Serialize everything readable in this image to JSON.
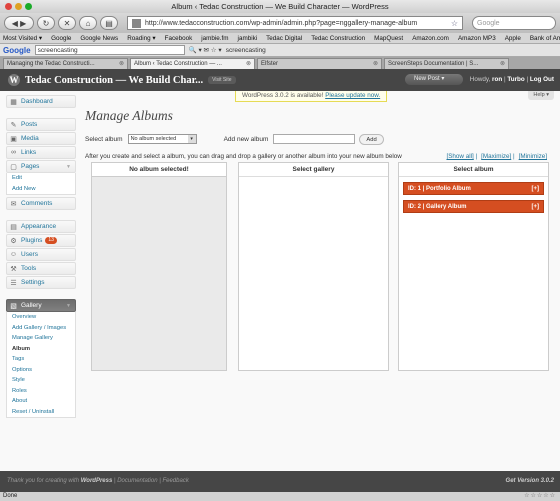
{
  "window": {
    "title": "Album ‹ Tedac Construction — We Build Character — WordPress"
  },
  "toolbar": {
    "url": "http://www.tedacconstruction.com/wp-admin/admin.php?page=nggallery-manage-album",
    "search_placeholder": "Google"
  },
  "bookmarks": [
    "Most Visited ▾",
    "Google",
    "Google News",
    "Roading ▾",
    "Facebook",
    "jambie.fm",
    "jambiki",
    "Tedac Digital",
    "Tedac Construction",
    "MapQuest",
    "Amazon.com",
    "Amazon MP3",
    "Apple",
    "Bank of America"
  ],
  "google_toolbar": {
    "logo": "Google",
    "search_value": "screencasting",
    "term": "screencasting"
  },
  "tabs": [
    {
      "label": "Managing the Tedac Constructi...",
      "active": false
    },
    {
      "label": "Album ‹ Tedac Construction — ...",
      "active": true
    },
    {
      "label": "Elfster",
      "active": false
    },
    {
      "label": "ScreenSteps Documentation | S...",
      "active": false
    }
  ],
  "wp_header": {
    "site_title": "Tedac Construction — We Build Char...",
    "visit_site": "Visit Site",
    "new_post": "New Post",
    "howdy_prefix": "Howdy,",
    "user": "ron",
    "turbo": "Turbo",
    "logout": "Log Out"
  },
  "notice": {
    "text": "WordPress 3.0.2 is available!",
    "link": "Please update now.",
    "help": "Help ▾"
  },
  "sidebar": {
    "dashboard": "Dashboard",
    "posts": "Posts",
    "media": "Media",
    "links": "Links",
    "pages": "Pages",
    "pages_sub": [
      "Edit",
      "Add New"
    ],
    "comments": "Comments",
    "appearance": "Appearance",
    "plugins": "Plugins",
    "plugins_badge": "13",
    "users": "Users",
    "tools": "Tools",
    "settings": "Settings",
    "gallery": "Gallery",
    "gallery_sub": [
      "Overview",
      "Add Gallery / Images",
      "Manage Gallery",
      "Album",
      "Tags",
      "Options",
      "Style",
      "Roles",
      "About",
      "Reset / Uninstall"
    ]
  },
  "main": {
    "title": "Manage Albums",
    "select_album_label": "Select album",
    "select_album_value": "No album selected",
    "add_new_album_label": "Add new album",
    "add_button": "Add",
    "instructions": "After you create and select a album, you can drag and drop a gallery or another album into your new album below",
    "show_all": "[Show all]",
    "maximize": "[Maximize]",
    "minimize": "[Minimize]",
    "col_left_title": "No album selected!",
    "col_mid_title": "Select gallery",
    "col_right_title": "Select album",
    "albums": [
      {
        "label": "ID: 1 | Portfolio Album",
        "action": "[+]"
      },
      {
        "label": "ID: 2 | Gallery Album",
        "action": "[+]"
      }
    ]
  },
  "footer": {
    "thanks": "Thank you for creating with",
    "wordpress": "WordPress",
    "documentation": "Documentation",
    "feedback": "Feedback",
    "version": "Get Version 3.0.2"
  },
  "status_bar": {
    "text": "Done"
  },
  "colors": {
    "accent": "#d54e21",
    "link": "#21759b",
    "header": "#464646"
  }
}
